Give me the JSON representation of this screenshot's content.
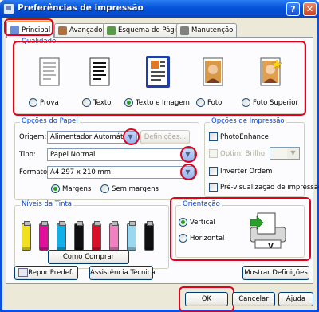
{
  "window": {
    "title": "Preferências de impressão",
    "help_glyph": "?",
    "close_glyph": "✕"
  },
  "tabs": [
    {
      "label": "Principal",
      "icon": "printer-check-icon",
      "active": true
    },
    {
      "label": "Avançado",
      "icon": "settings-icon",
      "active": false
    },
    {
      "label": "Esquema de Página",
      "icon": "layout-icon",
      "active": false
    },
    {
      "label": "Manutenção",
      "icon": "maintenance-icon",
      "active": false
    }
  ],
  "quality": {
    "group_label": "Qualidade",
    "options": [
      {
        "label": "Prova",
        "icon": "draft-page-icon",
        "selected": false
      },
      {
        "label": "Texto",
        "icon": "text-page-icon",
        "selected": false
      },
      {
        "label": "Texto e Imagem",
        "icon": "text-image-page-icon",
        "selected": true
      },
      {
        "label": "Foto",
        "icon": "photo-icon",
        "selected": false
      },
      {
        "label": "Foto Superior",
        "icon": "best-photo-icon",
        "selected": false
      }
    ]
  },
  "paper": {
    "group_label": "Opções do Papel",
    "source_label": "Origem:",
    "source_value": "Alimentador Automático",
    "settings_button": "Definições...",
    "type_label": "Tipo:",
    "type_value": "Papel Normal",
    "size_label": "Formato:",
    "size_value": "A4 297 x 210 mm",
    "margins_label": "Margens",
    "borderless_label": "Sem margens",
    "margins_selected": true
  },
  "print_options": {
    "group_label": "Opções de Impressão",
    "photo_enhance": "PhotoEnhance",
    "brightness_label": "Optim. Brilho",
    "reverse_order": "Inverter Ordem",
    "preview": "Pré-visualização de impressão"
  },
  "ink": {
    "group_label": "Níveis da Tinta",
    "buy_button": "Como Comprar",
    "cartridges": [
      {
        "color": "#f0e020",
        "icon": "yellow-cartridge-icon"
      },
      {
        "color": "#e0109a",
        "icon": "magenta-cartridge-icon"
      },
      {
        "color": "#10b0e8",
        "icon": "cyan-cartridge-icon"
      },
      {
        "color": "#101010",
        "icon": "black-cartridge-icon"
      },
      {
        "color": "#d8102a",
        "icon": "red-cartridge-icon"
      },
      {
        "color": "#f080c0",
        "icon": "light-magenta-cartridge-icon"
      },
      {
        "color": "#9ad8f0",
        "icon": "light-cyan-cartridge-icon"
      },
      {
        "color": "#101010",
        "icon": "matte-black-cartridge-icon"
      }
    ]
  },
  "orientation": {
    "group_label": "Orientação",
    "portrait": "Vertical",
    "landscape": "Horizontal",
    "portrait_selected": true,
    "illustration_letter": "V"
  },
  "panel_footer": {
    "reset_button": "Repor Predef.",
    "support_button": "Assistência Técnica",
    "show_settings_button": "Mostrar Definições"
  },
  "dialog_buttons": {
    "ok": "OK",
    "cancel": "Cancelar",
    "help": "Ajuda"
  },
  "colors": {
    "highlight_red": "#e3001b",
    "group_label_blue": "#0046d5",
    "titlebar_blue": "#0553d9"
  }
}
